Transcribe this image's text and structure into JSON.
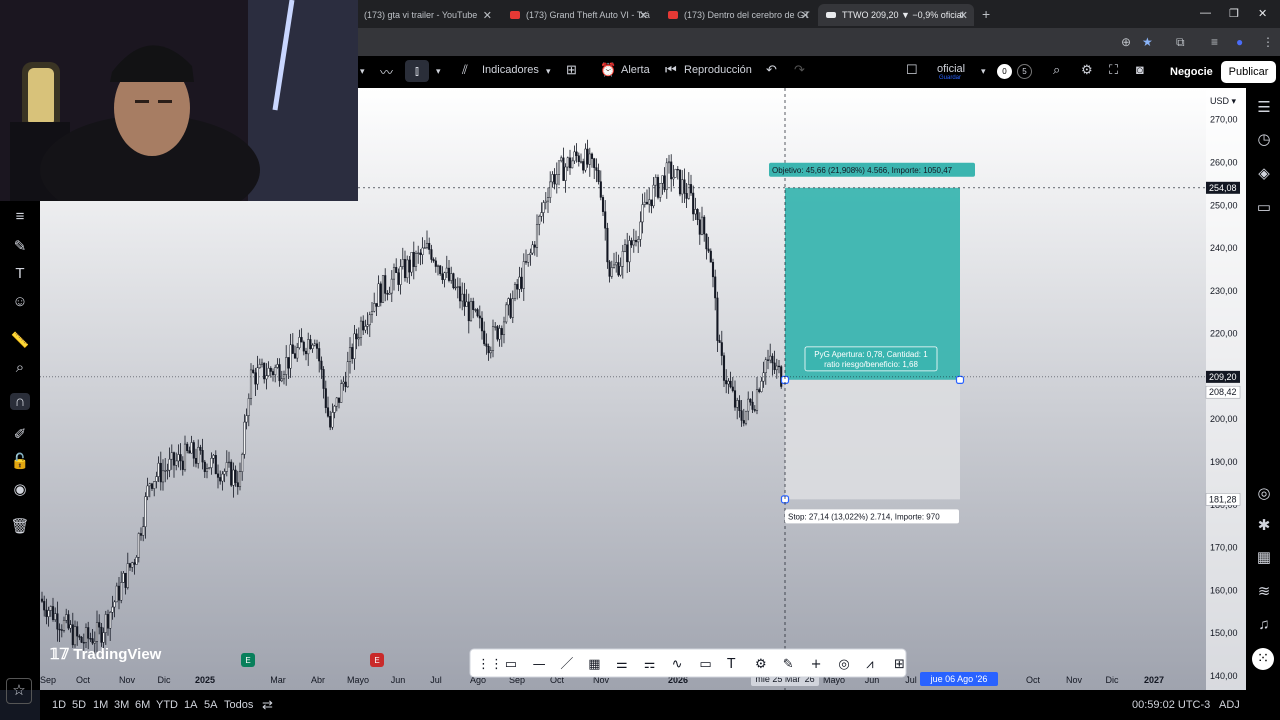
{
  "browser": {
    "tabs": [
      {
        "title": "(173) gta vi trailer - YouTube",
        "active": false
      },
      {
        "title": "(173) Grand Theft Auto VI - Trá",
        "active": false
      },
      {
        "title": "(173) Dentro del cerebro de GT",
        "active": false
      },
      {
        "title": "TTWO 209,20 ▼ −0,9% oficial",
        "active": true
      }
    ]
  },
  "toolbar": {
    "indicators": "Indicadores",
    "alert": "Alerta",
    "replay": "Reproducción",
    "layout_name": "oficial",
    "layout_status": "Guardar",
    "counter_1": "0",
    "counter_2": "5",
    "trade": "Negocie",
    "publish": "Publicar"
  },
  "chart": {
    "currency": "USD",
    "watermark": "TradingView",
    "price_axis_labels": [
      "270,00",
      "260,00",
      "250,00",
      "240,00",
      "230,00",
      "220,00",
      "210,00",
      "200,00",
      "190,00",
      "180,00",
      "170,00",
      "160,00",
      "150,00",
      "140,00"
    ],
    "price_badges": [
      {
        "label": "254,08",
        "style": "dark"
      },
      {
        "label": "209,20",
        "style": "dark"
      },
      {
        "label": "208,42",
        "style": "light"
      },
      {
        "label": "181,28",
        "style": "light"
      }
    ],
    "time_axis_labels": [
      "Sep",
      "Oct",
      "Nov",
      "Dic",
      "2025",
      "Mar",
      "Abr",
      "Mayo",
      "Jun",
      "Jul",
      "Ago",
      "Sep",
      "Oct",
      "Nov",
      "2026",
      "Mayo",
      "Jun",
      "Jul",
      "Oct",
      "Nov",
      "Dic",
      "2027"
    ],
    "time_badges": [
      "mié 25 Mar '26",
      "jue 06 Ago '26"
    ],
    "position": {
      "target_label": "Objetivo: 45,66 (21,908%) 4.566, Importe: 1050,47",
      "stop_label": "Stop: 27,14 (13,022%) 2.714, Importe: 970",
      "pnl_line1": "PyG Apertura: 0,78, Cantidad: 1",
      "pnl_line2": "ratio riesgo/beneficio: 1,68",
      "entry": 209.2,
      "target": 254.08,
      "stop": 181.28,
      "profit_color": "#3bb5b0",
      "loss_color": "#dcdde0"
    },
    "price_range": [
      140,
      276
    ],
    "last_price_marker": "254,08"
  },
  "bottom": {
    "ranges": [
      "1D",
      "5D",
      "1M",
      "3M",
      "6M",
      "YTD",
      "1A",
      "5A",
      "Todos"
    ],
    "clock": "00:59:02 UTC-3",
    "adj": "ADJ"
  }
}
